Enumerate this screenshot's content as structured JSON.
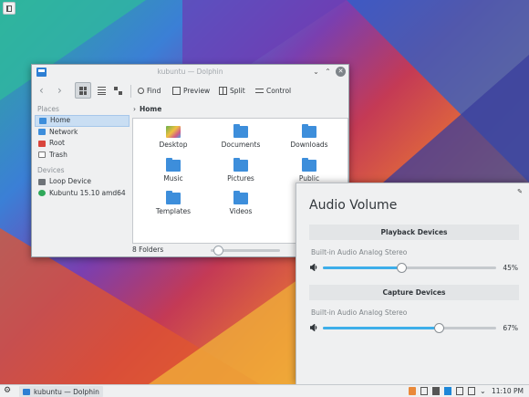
{
  "window": {
    "title": "kubuntu — Dolphin",
    "toolbar": {
      "find": "Find",
      "preview": "Preview",
      "split": "Split",
      "control": "Control"
    },
    "breadcrumb": "Home",
    "places_header": "Places",
    "places": [
      "Home",
      "Network",
      "Root",
      "Trash"
    ],
    "devices_header": "Devices",
    "devices": [
      "Loop Device",
      "Kubuntu 15.10 amd64"
    ],
    "folders": [
      "Desktop",
      "Documents",
      "Downloads",
      "Music",
      "Pictures",
      "Public",
      "Templates",
      "Videos"
    ],
    "status": "8 Folders"
  },
  "audio": {
    "title": "Audio Volume",
    "playback_header": "Playback Devices",
    "playback_device": "Built-in Audio Analog Stereo",
    "playback_volume": "45%",
    "playback_level": 45,
    "capture_header": "Capture Devices",
    "capture_device": "Built-in Audio Analog Stereo",
    "capture_volume": "67%",
    "capture_level": 67
  },
  "taskbar": {
    "task": "kubuntu — Dolphin",
    "clock": "11:10 PM"
  },
  "colors": {
    "accent": "#3daee9",
    "folder": "#3d8edb"
  }
}
